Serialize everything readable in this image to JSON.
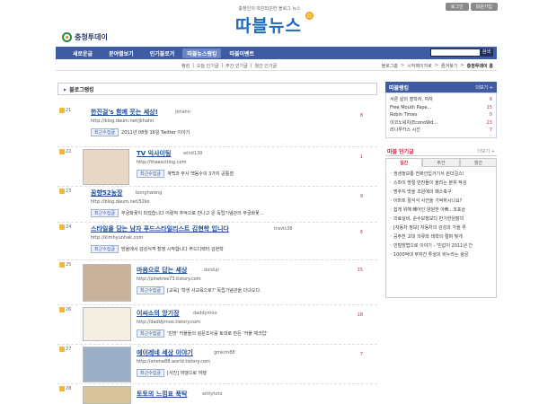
{
  "header": {
    "util_buttons": [
      "로그인",
      "회원가입"
    ],
    "slogan": "충청인의 따끈따끈한 블로그 뉴스",
    "logo_text": "따블뉴스",
    "brand_name": "충청투데이"
  },
  "nav": {
    "items": [
      "새로운글",
      "분야별보기",
      "인기블로거",
      "따블뉴스랭킹",
      "따블이벤트"
    ],
    "active_index": 3,
    "search_button": "검색"
  },
  "subnav": {
    "items": [
      "랭킹",
      "|",
      "오늘 인기글",
      "|",
      "주간 인기글",
      "|",
      "월간 인기글"
    ],
    "crumbs": [
      "블로그홈",
      ">",
      "시작페이지로",
      ">",
      "즐겨찾기",
      ">",
      "충청투데이 홈"
    ]
  },
  "section_title": "블로그랭킹",
  "entries": [
    {
      "rank": "21",
      "title": "한진걸's 함께 웃는 세상!",
      "author": "jkhahn",
      "url": "http://blog.daum.net/jkhahn",
      "tag": "최근수집글",
      "summary": "2011년 08월 16일 Twitter 이야기",
      "count": "8",
      "photo": false
    },
    {
      "rank": "22",
      "title": "TV 익사이팅",
      "author": "wind139",
      "url": "http://theexciting.com",
      "tag": "최근수집글",
      "summary": "계백과 부사 백동수의 3가지 공통점",
      "count": "1",
      "photo": true
    },
    {
      "rank": "23",
      "title": "꿈향52농장",
      "author": "bonghwang",
      "url": "http://blog.daum.net/52ko",
      "tag": "최근수집글",
      "summary": "무궁화꽃이 피었습니다 어렸적 추억으로 만나고 온 독립기념관의 무궁화꽃...",
      "count": "9",
      "photo": false
    },
    {
      "rank": "24",
      "title": "스타일을 담는 남자 푸드스타일리스트 김현학 입니다",
      "author": "travis38",
      "url": "http://kimhyunhak.com",
      "tag": "최근수집글",
      "summary": "방울에서 감성식객 촬영 시작합니다 푸드디렉터 김현학",
      "count": "6",
      "photo": false
    },
    {
      "rank": "25",
      "title": "마음으로 답는 세상",
      "author": "dolduji",
      "url": "http://pinetree73.tistory.com",
      "tag": "최근수집글",
      "summary": "[교육] '학생 사교육으로?' 독립기념관을 다녀오다.",
      "count": "15",
      "photo": true
    },
    {
      "rank": "26",
      "title": "이씨소의 앙기장",
      "author": "daddymoo",
      "url": "http://daddymoo.tistory.com",
      "tag": "최근수집글",
      "summary": "'빈방' 커플들의 설문조사를 토대로 만든 '커플 체크업'",
      "count": "18",
      "photo": true
    },
    {
      "rank": "27",
      "title": "에이레네 세상 이야기",
      "author": "gmkim88",
      "url": "http://eirene88.world.tistory.com",
      "tag": "최근수집글",
      "summary": "[사진] 여행으로 여행",
      "count": "7",
      "photo": true
    },
    {
      "rank": "28",
      "title": "토토의 느낌표 푹탁",
      "author": "wittytoto",
      "url": "",
      "tag": "",
      "summary": "",
      "count": "",
      "photo": true
    }
  ],
  "ranking_box": {
    "title": "따블랭킹",
    "more": "더보기 +",
    "rows": [
      {
        "label": "서른 살의 철학자, 여자",
        "count": "6"
      },
      {
        "label": "Free Mouth Pape...",
        "count": "15"
      },
      {
        "label": "Robin Times",
        "count": "0"
      },
      {
        "label": "이코노워치(EconoWd...",
        "count": "23"
      },
      {
        "label": "리나루카스 시선",
        "count": "7"
      }
    ]
  },
  "popular": {
    "title": "따블 인기글",
    "more": "더보기 +",
    "tabs": [
      "일간",
      "주간",
      "월간"
    ],
    "active_tab": 0,
    "items": [
      "생생정보통 전화인입거기서 원더걸스!",
      "스마이 명절 반찬들이 올리는 분위 작성",
      "명추치 맛을 조원에의 패스축구",
      "이마트 절식식 사건을 기억하시나요?",
      "쉽게 위해 빼어인 양원한 아빠...코포상",
      "의료실비, 순수보장보다 반기한원장의",
      "[자동차 정보] 자동차의 감성과 가을 루",
      "공주찬 고대 의류와 태학의 절며 빛개",
      "빈털방법으로 이야기 - '빈값이 2011년 간",
      "1000억대 부자간 투설의 비누라는 왕궁"
    ]
  }
}
